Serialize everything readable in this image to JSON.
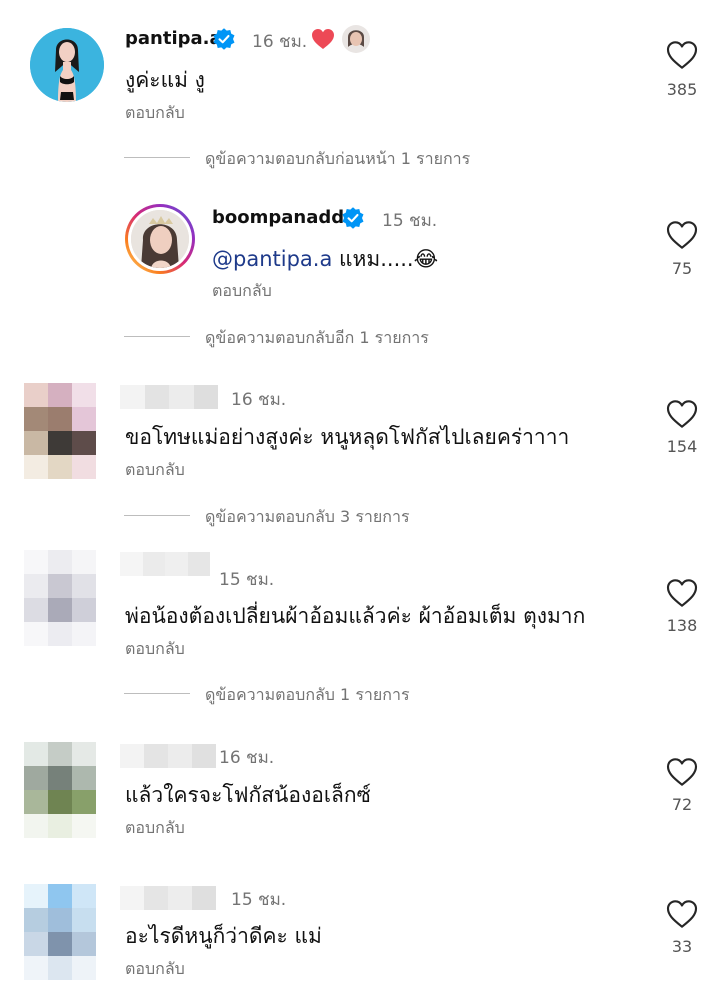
{
  "threads": [
    {
      "username": "pantipa.a",
      "time": "16 ชม.",
      "text": "งูค่ะแม่ งู",
      "reply": "ตอบกลับ",
      "likes": "385",
      "view_replies": "ดูข้อความตอบกลับก่อนหน้า 1 รายการ",
      "avatar_icon": "woman-illustration-avatar"
    },
    {
      "username": "boompanadda",
      "time": "15 ชม.",
      "mention": "@pantipa.a",
      "text": " แหม.....",
      "emoji": "😂",
      "reply": "ตอบกลับ",
      "likes": "75",
      "view_replies": "ดูข้อความตอบกลับอีก 1 รายการ"
    },
    {
      "time": "16 ชม.",
      "text": "ขอโทษแม่อย่างสูงค่ะ หนูหลุดโฟกัสไปเลยคร่าาาา",
      "reply": "ตอบกลับ",
      "likes": "154",
      "view_replies": "ดูข้อความตอบกลับ 3 รายการ"
    },
    {
      "time": "15 ชม.",
      "text": "พ่อน้องต้องเปลี่ยนผ้าอ้อมแล้วค่ะ ผ้าอ้อมเต็ม ตุงมาก",
      "reply": "ตอบกลับ",
      "likes": "138",
      "view_replies": "ดูข้อความตอบกลับ 1 รายการ"
    },
    {
      "time": "16 ชม.",
      "text": "แล้วใครจะโฟกัสน้องอเล็กซ์",
      "reply": "ตอบกลับ",
      "likes": "72"
    },
    {
      "time": "15 ชม.",
      "text": "อะไรดีหนูก็ว่าดีคะ แม่",
      "reply": "ตอบกลับ",
      "likes": "33"
    }
  ],
  "colors": {
    "verified": "#0095f6",
    "heart_red": "#ed4956",
    "mention": "#1e3a8a",
    "muted": "#737373"
  }
}
